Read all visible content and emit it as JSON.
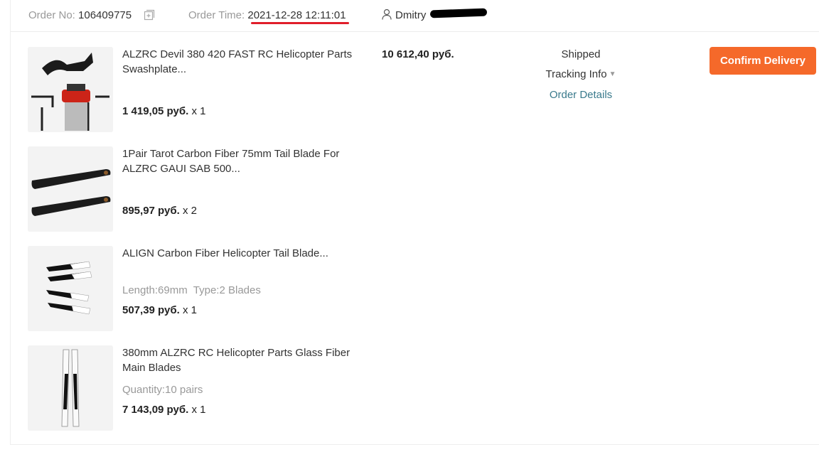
{
  "header": {
    "order_no_label": "Order No:",
    "order_no": "106409775",
    "order_time_label": "Order Time:",
    "order_time": "2021-12-28 12:11:01",
    "user_name": "Dmitry"
  },
  "items": [
    {
      "title": "ALZRC Devil 380 420 FAST RC Helicopter Parts Swashplate...",
      "attr": "",
      "price": "1 419,05 руб.",
      "qty": "x 1"
    },
    {
      "title": "1Pair Tarot Carbon Fiber 75mm Tail Blade For ALZRC GAUI SAB 500...",
      "attr": "",
      "price": "895,97 руб.",
      "qty": "x 2"
    },
    {
      "title": "ALIGN Carbon Fiber Helicopter Tail Blade...",
      "attr": "Length:69mm  Type:2 Blades",
      "price": "507,39 руб.",
      "qty": "x 1"
    },
    {
      "title": "380mm ALZRC RC Helicopter Parts Glass Fiber Main Blades",
      "attr": "Quantity:10 pairs",
      "price": "7 143,09 руб.",
      "qty": "x 1"
    }
  ],
  "order_total": "10 612,40 руб.",
  "status": {
    "state": "Shipped",
    "tracking_label": "Tracking Info",
    "details_label": "Order Details"
  },
  "actions": {
    "confirm_label": "Confirm Delivery"
  },
  "colors": {
    "accent": "#f5692a",
    "link": "#3a7a8c",
    "highlight_underline": "#e01e2a"
  }
}
